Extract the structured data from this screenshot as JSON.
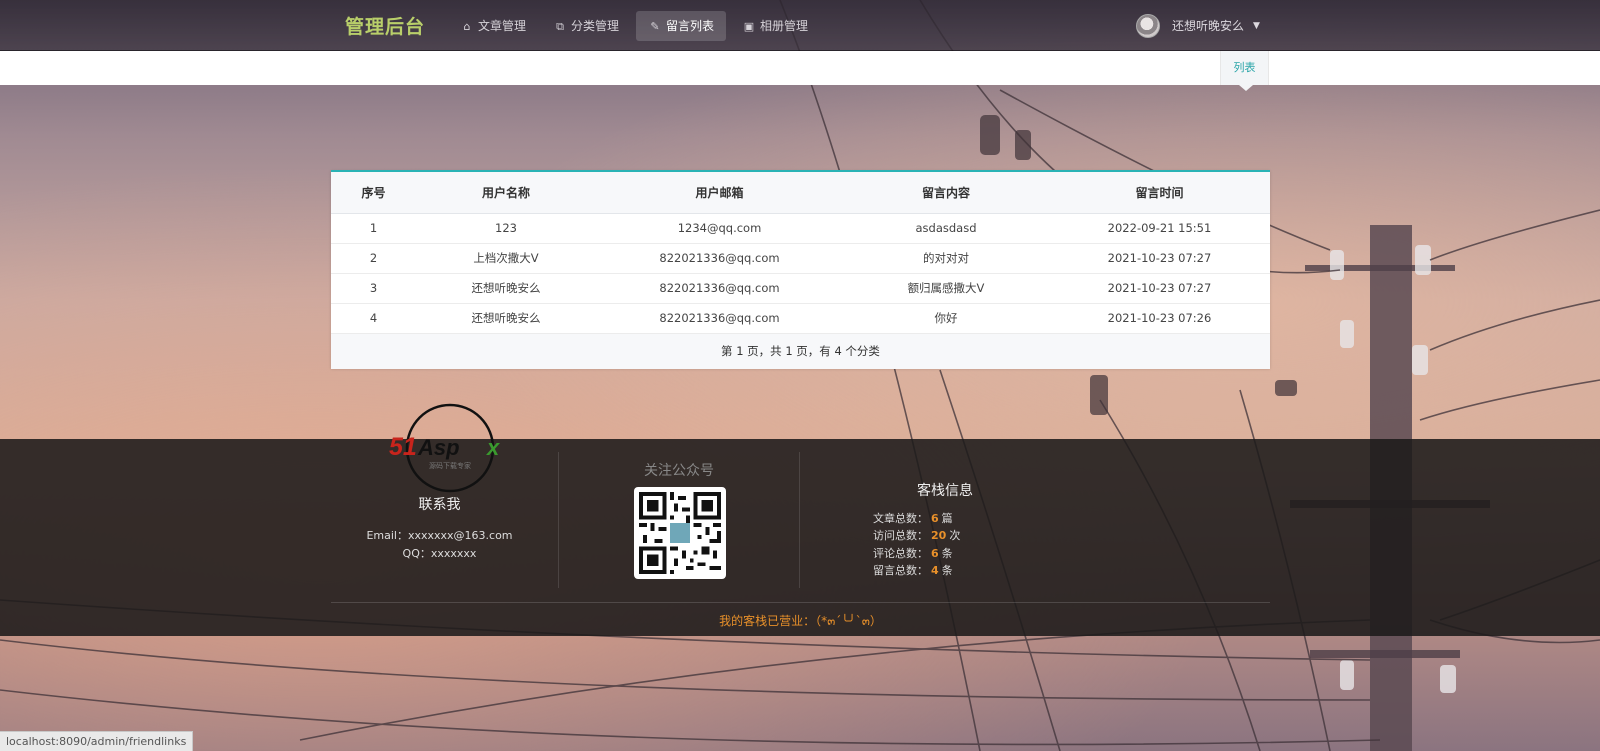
{
  "brand": "管理后台",
  "nav": [
    {
      "label": "文章管理",
      "icon": "home-icon",
      "active": false
    },
    {
      "label": "分类管理",
      "icon": "copy-icon",
      "active": false
    },
    {
      "label": "留言列表",
      "icon": "pencil-icon",
      "active": true
    },
    {
      "label": "相册管理",
      "icon": "image-icon",
      "active": false
    }
  ],
  "user": {
    "name": "还想听晚安么"
  },
  "subbar": {
    "tab_label": "列表"
  },
  "table": {
    "headers": [
      "序号",
      "用户名称",
      "用户邮箱",
      "留言内容",
      "留言时间"
    ],
    "rows": [
      [
        "1",
        "123",
        "1234@qq.com",
        "asdasdasd",
        "2022-09-21 15:51"
      ],
      [
        "2",
        "上档次撒大V",
        "822021336@qq.com",
        "的对对对",
        "2021-10-23 07:27"
      ],
      [
        "3",
        "还想听晚安么",
        "822021336@qq.com",
        "额归属感撒大V",
        "2021-10-23 07:27"
      ],
      [
        "4",
        "还想听晚安么",
        "822021336@qq.com",
        "你好",
        "2021-10-23 07:26"
      ]
    ],
    "pagination": "第 1 页，共 1 页，有 4 个分类"
  },
  "footer": {
    "logo_text": "51Aspx",
    "logo_subtext": "源码下载专家",
    "contact_title": "联系我",
    "email": "Email：xxxxxxx@163.com",
    "qq": "QQ：xxxxxxx",
    "wechat_title": "关注公众号",
    "stats_title": "客栈信息",
    "stats": [
      {
        "label": "文章总数：",
        "value": "6",
        "unit": "篇"
      },
      {
        "label": "访问总数：",
        "value": "20",
        "unit": "次"
      },
      {
        "label": "评论总数：",
        "value": "6",
        "unit": "条"
      },
      {
        "label": "留言总数：",
        "value": "4",
        "unit": "条"
      }
    ],
    "slogan": "我的客栈已营业：（*๓´╰╯`๓）"
  },
  "statusbar": {
    "url": "localhost:8090/admin/friendlinks"
  },
  "colors": {
    "brand": "#b9cf6a",
    "accent": "#2ab3b5",
    "highlight": "#e8902a"
  }
}
